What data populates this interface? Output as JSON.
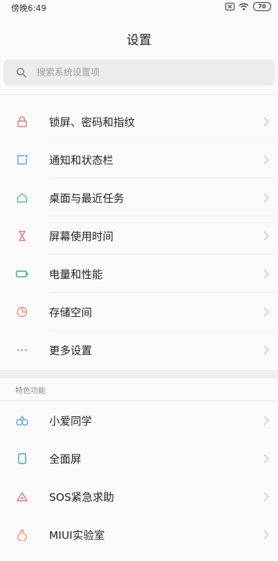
{
  "status_bar": {
    "time": "傍晚6:49",
    "battery": "70"
  },
  "header": {
    "title": "设置"
  },
  "search": {
    "placeholder": "搜索系统设置项"
  },
  "main_items": [
    {
      "label": "锁屏、密码和指纹",
      "icon": "lock-icon",
      "color": "#e57373"
    },
    {
      "label": "通知和状态栏",
      "icon": "notification-icon",
      "color": "#4fa8d8"
    },
    {
      "label": "桌面与最近任务",
      "icon": "home-icon",
      "color": "#4fb6a8"
    },
    {
      "label": "屏幕使用时间",
      "icon": "hourglass-icon",
      "color": "#e57373"
    },
    {
      "label": "电量和性能",
      "icon": "battery-icon",
      "color": "#3aa5a0"
    },
    {
      "label": "存储空间",
      "icon": "storage-icon",
      "color": "#f08a6a"
    },
    {
      "label": "更多设置",
      "icon": "more-icon",
      "color": "#4fa8d8"
    }
  ],
  "special_section": {
    "label": "特色功能",
    "items": [
      {
        "label": "小爱同学",
        "icon": "xiaoai-icon",
        "color": "#4fa8d8"
      },
      {
        "label": "全面屏",
        "icon": "fullscreen-icon",
        "color": "#3aa5a0"
      },
      {
        "label": "SOS紧急求助",
        "icon": "sos-icon",
        "color": "#e57373"
      },
      {
        "label": "MIUI实验室",
        "icon": "lab-icon",
        "color": "#f08a6a"
      }
    ]
  }
}
